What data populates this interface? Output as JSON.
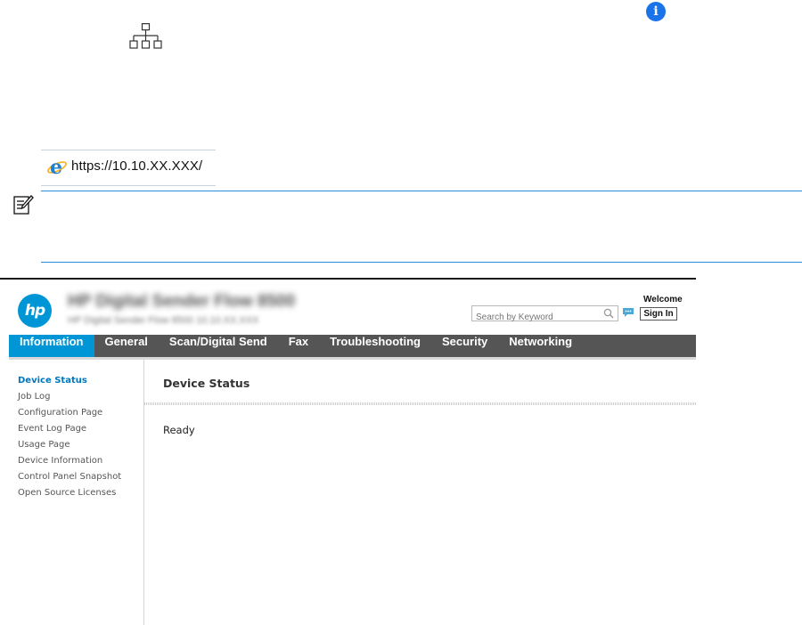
{
  "doc": {
    "info_icon": "info-icon",
    "network_icon": "network-icon",
    "note_icon": "note-icon",
    "url_bar": {
      "browser_icon": "internet-explorer-icon",
      "url": "https://10.10.XX.XXX/"
    }
  },
  "ews": {
    "logo_text": "hp",
    "device_name": "HP Digital Sender Flow 8500",
    "device_subtitle": "HP Digital Sender Flow 8500    10.10.XX.XXX",
    "search": {
      "placeholder": "Search by Keyword",
      "icon": "search-icon"
    },
    "chat_icon": "chat-icon",
    "welcome": "Welcome",
    "sign_in": "Sign In",
    "accent_color": "#0096d6",
    "nav_tabs": [
      {
        "label": "Information",
        "active": true
      },
      {
        "label": "General"
      },
      {
        "label": "Scan/Digital Send"
      },
      {
        "label": "Fax"
      },
      {
        "label": "Troubleshooting"
      },
      {
        "label": "Security"
      },
      {
        "label": "Networking"
      }
    ],
    "left_menu": [
      {
        "label": "Device Status",
        "active": true
      },
      {
        "label": "Job Log"
      },
      {
        "label": "Configuration Page"
      },
      {
        "label": "Event Log Page"
      },
      {
        "label": "Usage Page"
      },
      {
        "label": "Device Information"
      },
      {
        "label": "Control Panel Snapshot"
      },
      {
        "label": "Open Source Licenses"
      }
    ],
    "section_title": "Device Status",
    "status": "Ready"
  }
}
